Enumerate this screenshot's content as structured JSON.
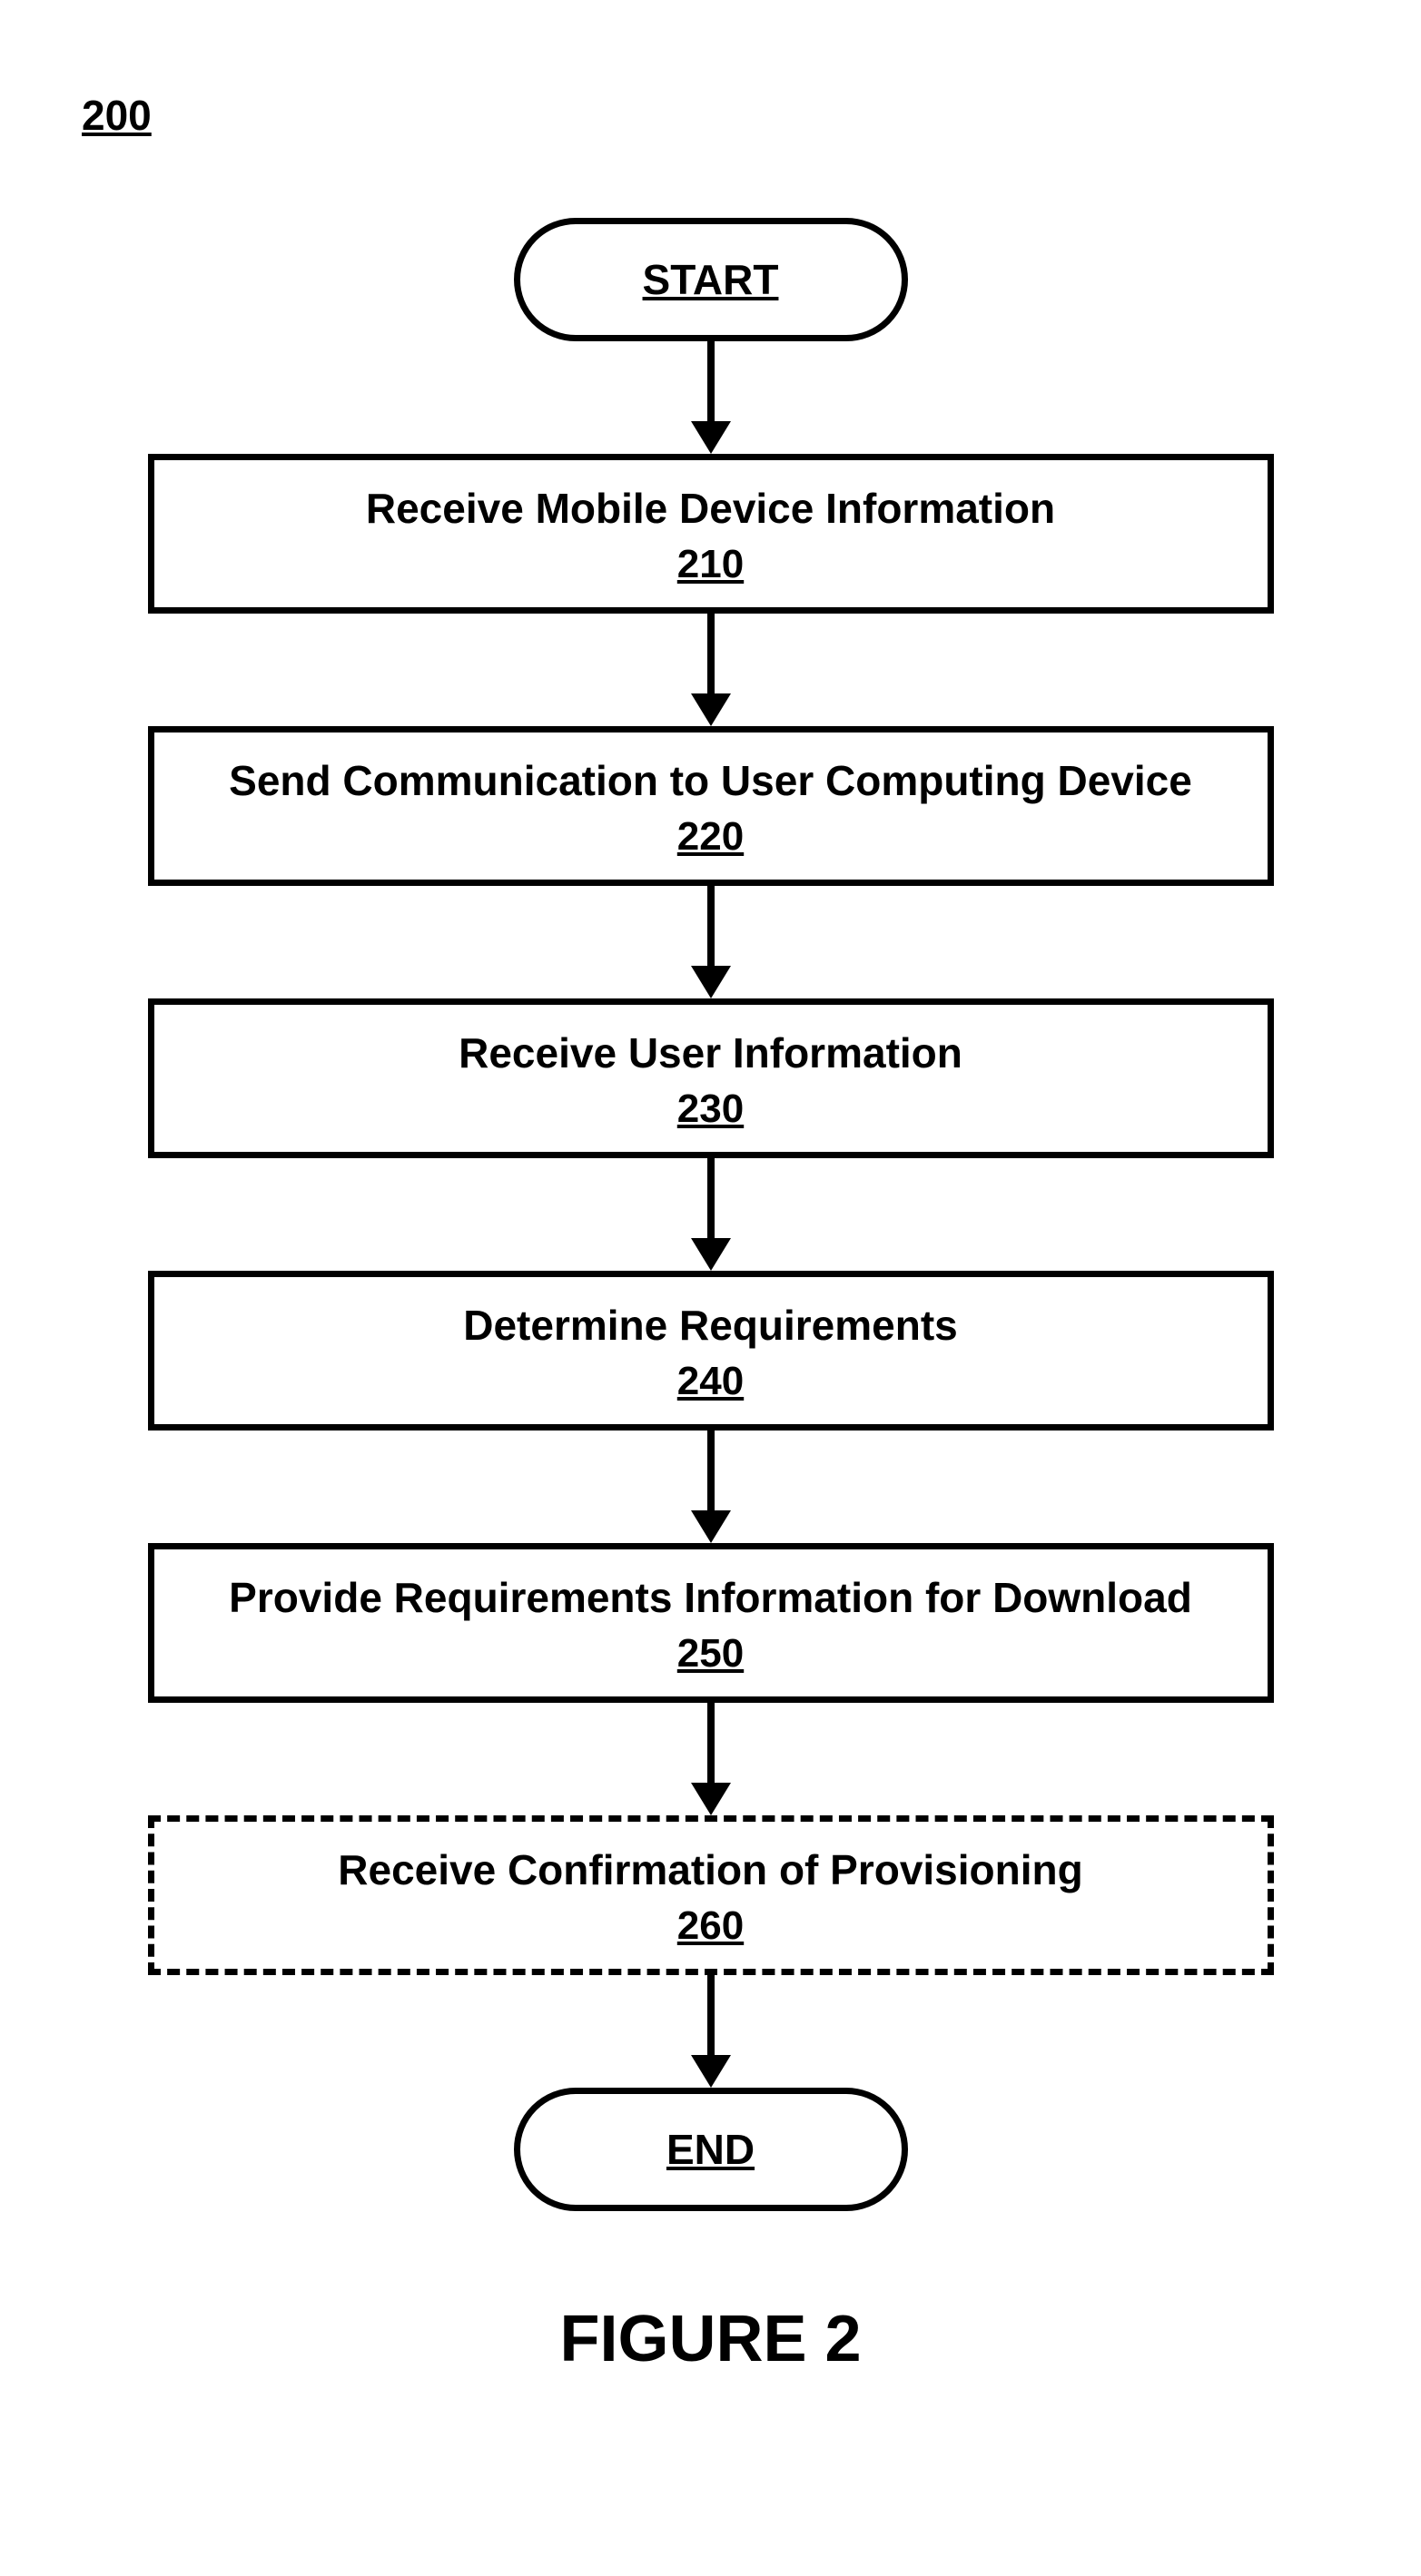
{
  "figure_number_label": "200",
  "terminators": {
    "start": "START",
    "end": "END"
  },
  "steps": [
    {
      "title": "Receive Mobile Device Information",
      "num": "210",
      "dashed": false
    },
    {
      "title": "Send Communication to User Computing Device",
      "num": "220",
      "dashed": false
    },
    {
      "title": "Receive User Information",
      "num": "230",
      "dashed": false
    },
    {
      "title": "Determine Requirements",
      "num": "240",
      "dashed": false
    },
    {
      "title": "Provide Requirements Information for Download",
      "num": "250",
      "dashed": false
    },
    {
      "title": "Receive Confirmation of Provisioning",
      "num": "260",
      "dashed": true
    }
  ],
  "caption": "FIGURE 2",
  "arrow_heights": {
    "after_start": 90,
    "between_steps": 90,
    "before_end": 90
  }
}
